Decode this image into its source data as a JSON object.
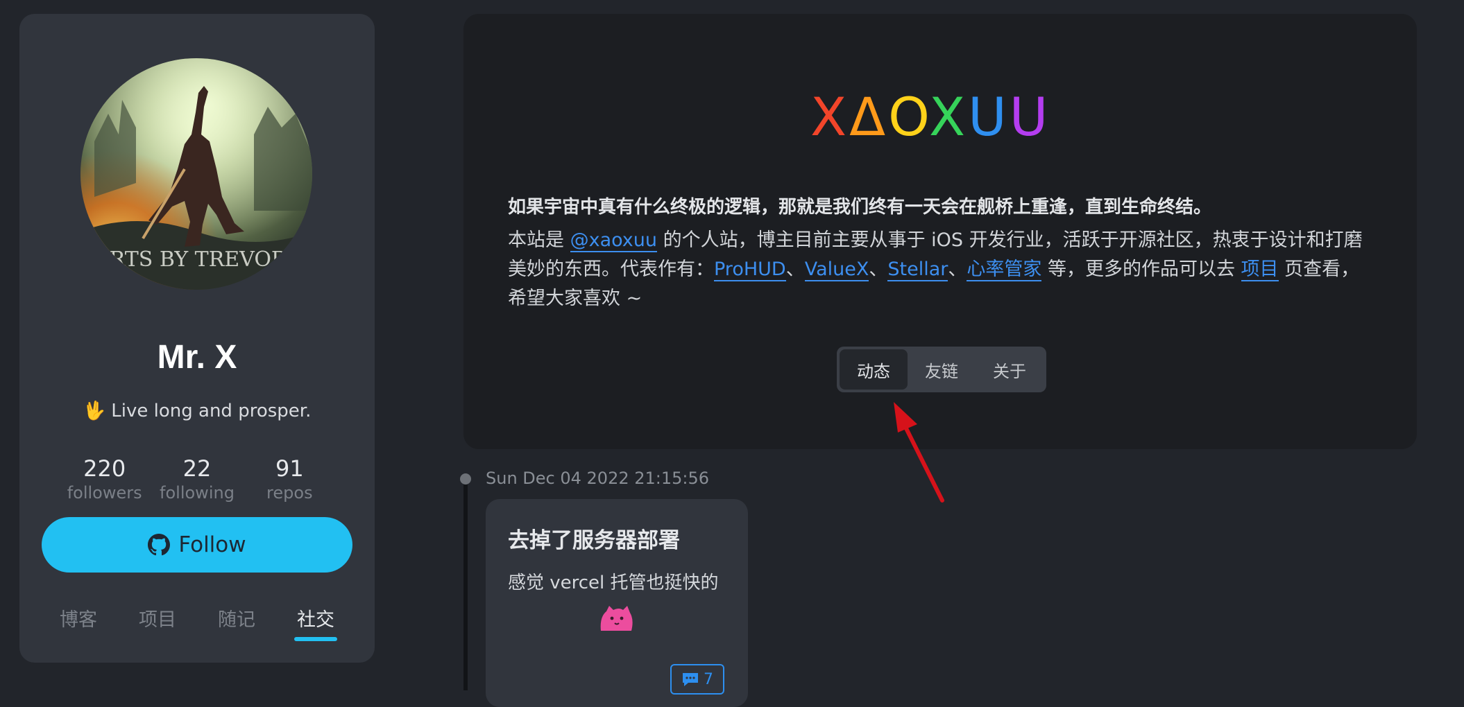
{
  "profile": {
    "avatar_caption": "ARTS BY TREVOR M",
    "name": "Mr. X",
    "motto": "🖖 Live long and prosper.",
    "stats": [
      {
        "value": "220",
        "label": "followers"
      },
      {
        "value": "22",
        "label": "following"
      },
      {
        "value": "91",
        "label": "repos"
      }
    ],
    "follow_label": "Follow",
    "nav": [
      "博客",
      "项目",
      "随记",
      "社交"
    ],
    "nav_active_index": 3
  },
  "hero": {
    "logo_letters": [
      "X",
      "Δ",
      "O",
      "X",
      "U",
      "U"
    ],
    "logo_colors": [
      "#f2452a",
      "#ff9a1a",
      "#ffd21a",
      "#36d35a",
      "#2f8ff0",
      "#b43df0"
    ],
    "quote": "如果宇宙中真有什么终极的逻辑，那就是我们终有一天会在舰桥上重逢，直到生命终结。",
    "intro": {
      "t1": "本站是 ",
      "handle": "@xaoxuu",
      "t2": " 的个人站，博主目前主要从事于 iOS 开发行业，活跃于开源社区，热衷于设计和打磨美妙的东西。代表作有：",
      "works": [
        "ProHUD",
        "ValueX",
        "Stellar",
        "心率管家"
      ],
      "sep": "、",
      "t3": " 等，更多的作品可以去 ",
      "projects": "项目",
      "t4": " 页查看，希望大家喜欢 ~"
    },
    "tabs": [
      "动态",
      "友链",
      "关于"
    ],
    "tab_active_index": 0
  },
  "feed": {
    "date": "Sun Dec 04 2022 21:15:56",
    "post_title": "去掉了服务器部署",
    "post_body": "感觉 vercel 托管也挺快的",
    "comment_count": "7"
  },
  "colors": {
    "accent": "#22c0f2",
    "link": "#3d8ff0",
    "arrow": "#d6121a"
  }
}
